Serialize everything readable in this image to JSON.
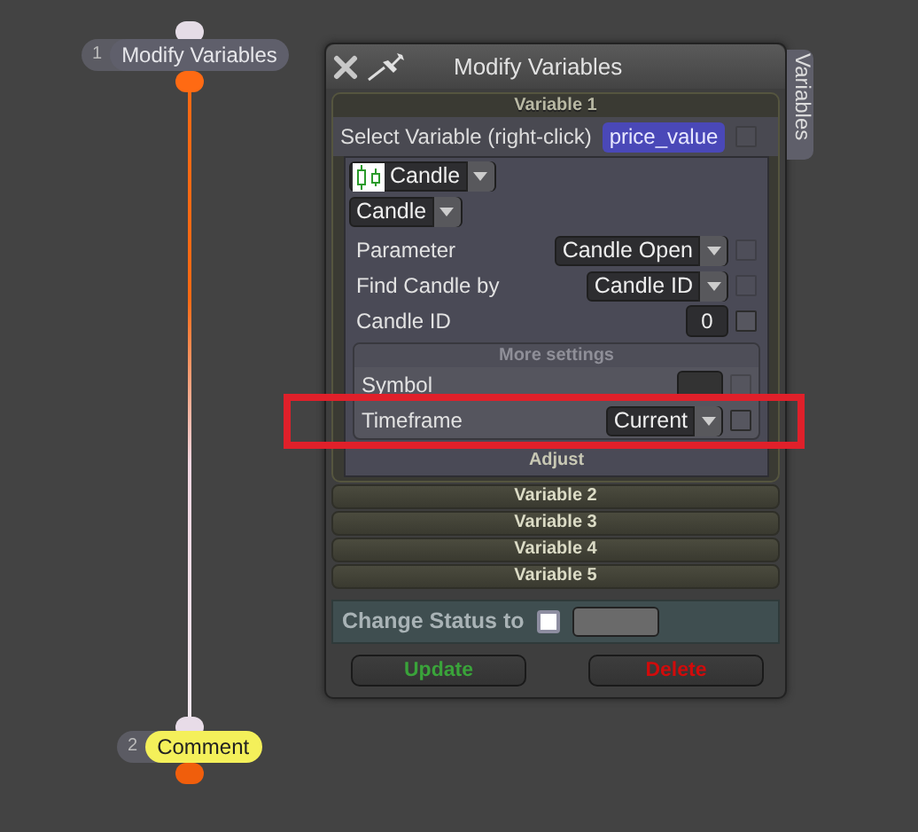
{
  "nodes": [
    {
      "number": "1",
      "label": "Modify Variables",
      "kind": "action"
    },
    {
      "number": "2",
      "label": "Comment",
      "kind": "comment"
    }
  ],
  "panel": {
    "title": "Modify Variables",
    "side_tab": "Variables",
    "variable_1": {
      "header": "Variable 1",
      "select_label": "Select Variable (right-click)",
      "variable_name": "price_value",
      "name_checkbox_disabled": true,
      "type": "Candle",
      "subtype": "Candle",
      "fields": [
        {
          "label": "Parameter",
          "kind": "select",
          "value": "Candle Open",
          "checkbox_disabled": true
        },
        {
          "label": "Find Candle by",
          "kind": "select",
          "value": "Candle ID",
          "checkbox_disabled": true
        },
        {
          "label": "Candle ID",
          "kind": "number",
          "value": "0",
          "checkbox_disabled": false
        }
      ],
      "more_settings": {
        "header": "More settings",
        "fields": [
          {
            "label": "Symbol",
            "kind": "swatch",
            "checkbox_disabled": true,
            "highlighted": false
          },
          {
            "label": "Timeframe",
            "kind": "select",
            "value": "Current",
            "checkbox_disabled": false,
            "highlighted": true
          }
        ]
      },
      "footer": "Adjust"
    },
    "other_variables": [
      {
        "header": "Variable 2"
      },
      {
        "header": "Variable 3"
      },
      {
        "header": "Variable 4"
      },
      {
        "header": "Variable 5"
      }
    ],
    "status": {
      "label": "Change Status to",
      "checked": false
    },
    "buttons": [
      {
        "label": "Update",
        "kind": "update"
      },
      {
        "label": "Delete",
        "kind": "delete"
      }
    ]
  }
}
